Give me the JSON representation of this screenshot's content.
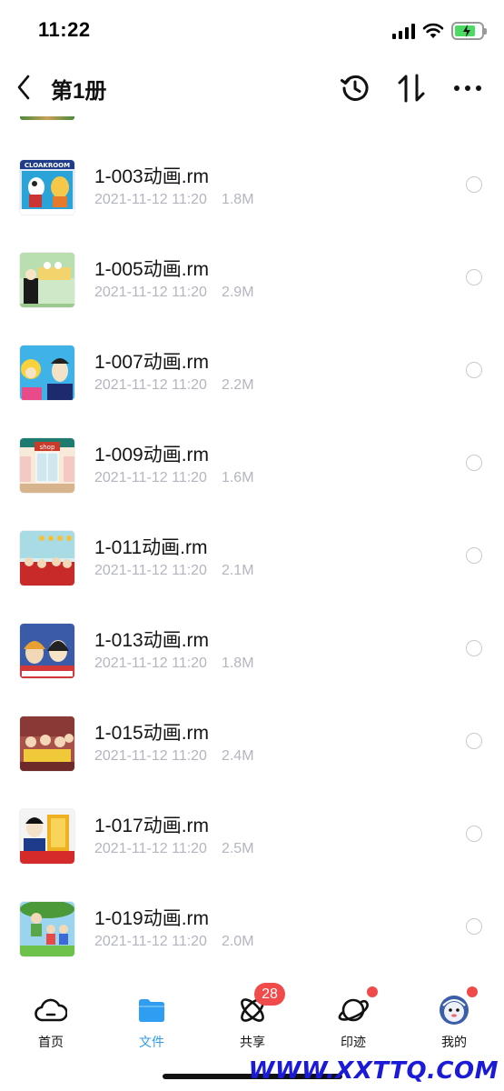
{
  "status_bar": {
    "time": "11:22"
  },
  "nav": {
    "title": "第1册",
    "actions": [
      "history-icon",
      "sort-icon",
      "more-icon"
    ]
  },
  "files": [
    {
      "name": "1-003动画.rm",
      "date": "2021-11-12 11:20",
      "size": "1.8M"
    },
    {
      "name": "1-005动画.rm",
      "date": "2021-11-12 11:20",
      "size": "2.9M"
    },
    {
      "name": "1-007动画.rm",
      "date": "2021-11-12 11:20",
      "size": "2.2M"
    },
    {
      "name": "1-009动画.rm",
      "date": "2021-11-12 11:20",
      "size": "1.6M"
    },
    {
      "name": "1-011动画.rm",
      "date": "2021-11-12 11:20",
      "size": "2.1M"
    },
    {
      "name": "1-013动画.rm",
      "date": "2021-11-12 11:20",
      "size": "1.8M"
    },
    {
      "name": "1-015动画.rm",
      "date": "2021-11-12 11:20",
      "size": "2.4M"
    },
    {
      "name": "1-017动画.rm",
      "date": "2021-11-12 11:20",
      "size": "2.5M"
    },
    {
      "name": "1-019动画.rm",
      "date": "2021-11-12 11:20",
      "size": "2.0M"
    }
  ],
  "thumb_texts": {
    "cloakroom": "CLOAKROOM",
    "shop": "shop"
  },
  "tabs": [
    {
      "label": "首页",
      "icon": "cloud-icon"
    },
    {
      "label": "文件",
      "icon": "folder-icon"
    },
    {
      "label": "共享",
      "icon": "atom-icon",
      "badge": "28"
    },
    {
      "label": "印迹",
      "icon": "planet-icon"
    },
    {
      "label": "我的",
      "icon": "avatar-icon"
    }
  ],
  "colors": {
    "accent": "#2f9df2",
    "badge": "#f04a4a",
    "meta": "#b3b6bf"
  },
  "watermark": "WWW.XXTTQ.COM"
}
